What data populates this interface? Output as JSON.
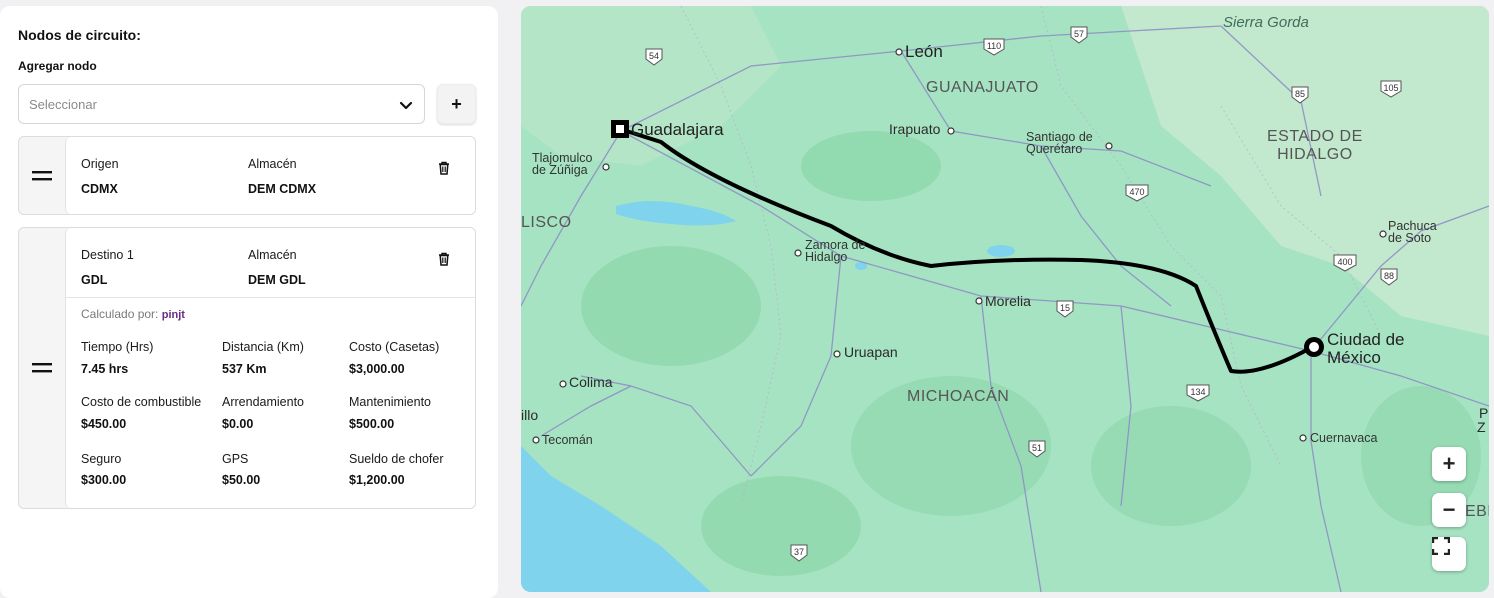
{
  "panel": {
    "title": "Nodos de circuito:",
    "add_label": "Agregar nodo",
    "select_placeholder": "Seleccionar",
    "add_button": "+"
  },
  "origin_card": {
    "type_label": "Origen",
    "type_value": "CDMX",
    "warehouse_label": "Almacén",
    "warehouse_value": "DEM CDMX"
  },
  "dest_card": {
    "type_label": "Destino 1",
    "type_value": "GDL",
    "warehouse_label": "Almacén",
    "warehouse_value": "DEM GDL",
    "calc_label": "Calculado por:",
    "calc_brand": "pinjt",
    "metrics": [
      {
        "label": "Tiempo (Hrs)",
        "value": "7.45 hrs"
      },
      {
        "label": "Distancia (Km)",
        "value": "537 Km"
      },
      {
        "label": "Costo (Casetas)",
        "value": "$3,000.00"
      },
      {
        "label": "Costo de combustible",
        "value": "$450.00"
      },
      {
        "label": "Arrendamiento",
        "value": "$0.00"
      },
      {
        "label": "Mantenimiento",
        "value": "$500.00"
      },
      {
        "label": "Seguro",
        "value": "$300.00"
      },
      {
        "label": "GPS",
        "value": "$50.00"
      },
      {
        "label": "Sueldo de chofer",
        "value": "$1,200.00"
      }
    ]
  },
  "map": {
    "places": {
      "leon": "León",
      "guanajuato": "GUANAJUATO",
      "guadalajara": "Guadalajara",
      "irapuato": "Irapuato",
      "santiago1": "Santiago de",
      "santiago2": "Querétaro",
      "estado1": "ESTADO DE",
      "estado2": "HIDALGO",
      "sierra": "Sierra Gorda",
      "tlajo1": "Tlajomulco",
      "tlajo2": "de Zúñiga",
      "jalisco": "LISCO",
      "zamora1": "Zamora de",
      "zamora2": "Hidalgo",
      "pachuca1": "Pachuca",
      "pachuca2": "de Soto",
      "morelia": "Morelia",
      "uruapan": "Uruapan",
      "cdmx1": "Ciudad de",
      "cdmx2": "México",
      "colima": "Colima",
      "michoacan": "MICHOACÁN",
      "illo": "illo",
      "tecoman": "Tecomán",
      "cuernavaca": "Cuernavaca",
      "ebl": "EBL",
      "pz1": "P",
      "pz2": "Z"
    },
    "shields": [
      "54",
      "110",
      "57",
      "85",
      "105",
      "470",
      "400",
      "88",
      "15",
      "134",
      "51",
      "37"
    ],
    "colors": {
      "land": "#9fe0bd",
      "water": "#7fd3ec",
      "route": "#000000",
      "roads": "#8e8fc6"
    },
    "zoom": {
      "in": "+",
      "out": "−"
    }
  }
}
